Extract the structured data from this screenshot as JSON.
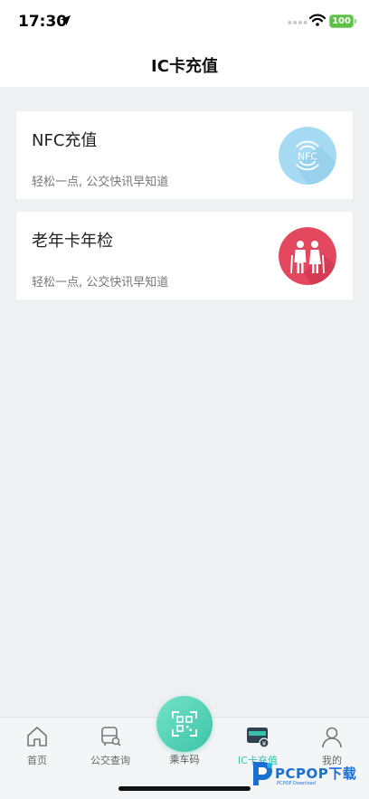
{
  "status_bar": {
    "time": "17:30",
    "battery": "100",
    "battery_color": "#5bc045"
  },
  "nav": {
    "title": "IC卡充值"
  },
  "cards": [
    {
      "title": "NFC充值",
      "subtitle": "轻松一点, 公交快讯早知道",
      "icon": "nfc-icon",
      "icon_text": "NFC",
      "icon_color": "#a6daf2"
    },
    {
      "title": "老年卡年检",
      "subtitle": "轻松一点, 公交快讯早知道",
      "icon": "elderly-couple-icon",
      "icon_color": "#e4485e"
    }
  ],
  "tabbar": {
    "items": [
      {
        "label": "首页",
        "icon": "home-icon"
      },
      {
        "label": "公交查询",
        "icon": "bus-search-icon"
      },
      {
        "label": "乘车码",
        "icon": "qr-code-icon"
      },
      {
        "label": "IC卡充值",
        "icon": "card-recharge-icon",
        "active": true
      },
      {
        "label": "我的",
        "icon": "profile-icon"
      }
    ],
    "active_color": "#3bbfad"
  },
  "watermark": {
    "text": "PCPOP下载",
    "sub": "PCPOP Download"
  }
}
